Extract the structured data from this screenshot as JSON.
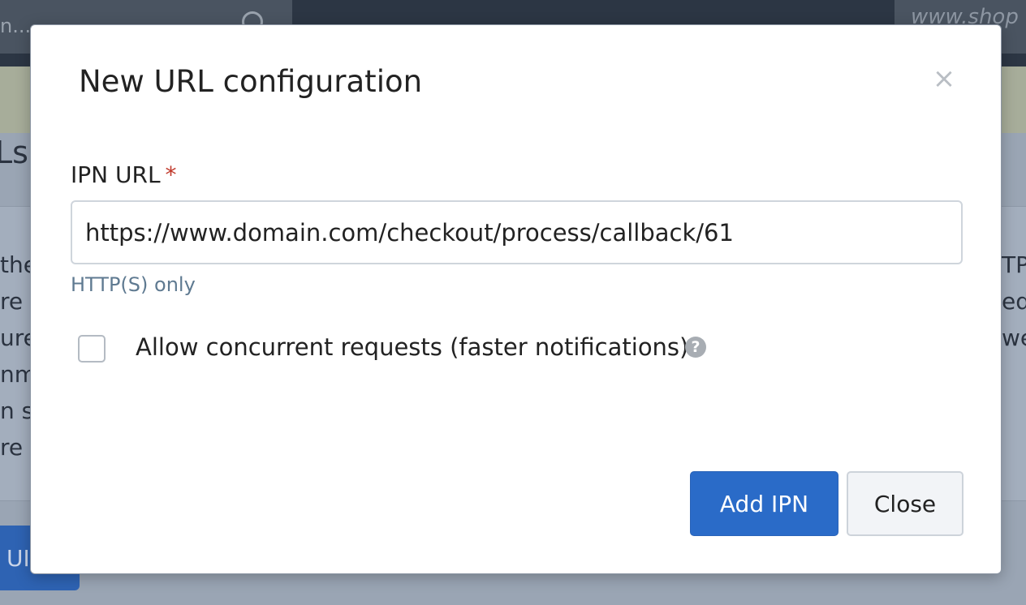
{
  "background": {
    "search_text": "n...",
    "shop_text": "www.shop",
    "heading_fragment": "Ls",
    "left_fragments": [
      "the",
      "re",
      "ure",
      "nm",
      "n s",
      "re"
    ],
    "right_fragments": [
      "TP",
      "ed",
      "we",
      "",
      "",
      ""
    ],
    "bottom_button_fragment": "UI"
  },
  "modal": {
    "title": "New URL configuration",
    "close_symbol": "×",
    "ipn_url": {
      "label": "IPN URL",
      "required_marker": "*",
      "value": "https://www.domain.com/checkout/process/callback/61",
      "help": "HTTP(S) only"
    },
    "concurrent": {
      "label": "Allow concurrent requests (faster notifications)",
      "checked": false,
      "help_icon": "?"
    },
    "buttons": {
      "add": "Add IPN",
      "close": "Close"
    }
  },
  "colors": {
    "primary": "#2a6bc8",
    "required": "#c0392b",
    "help_text": "#5f7a91"
  }
}
